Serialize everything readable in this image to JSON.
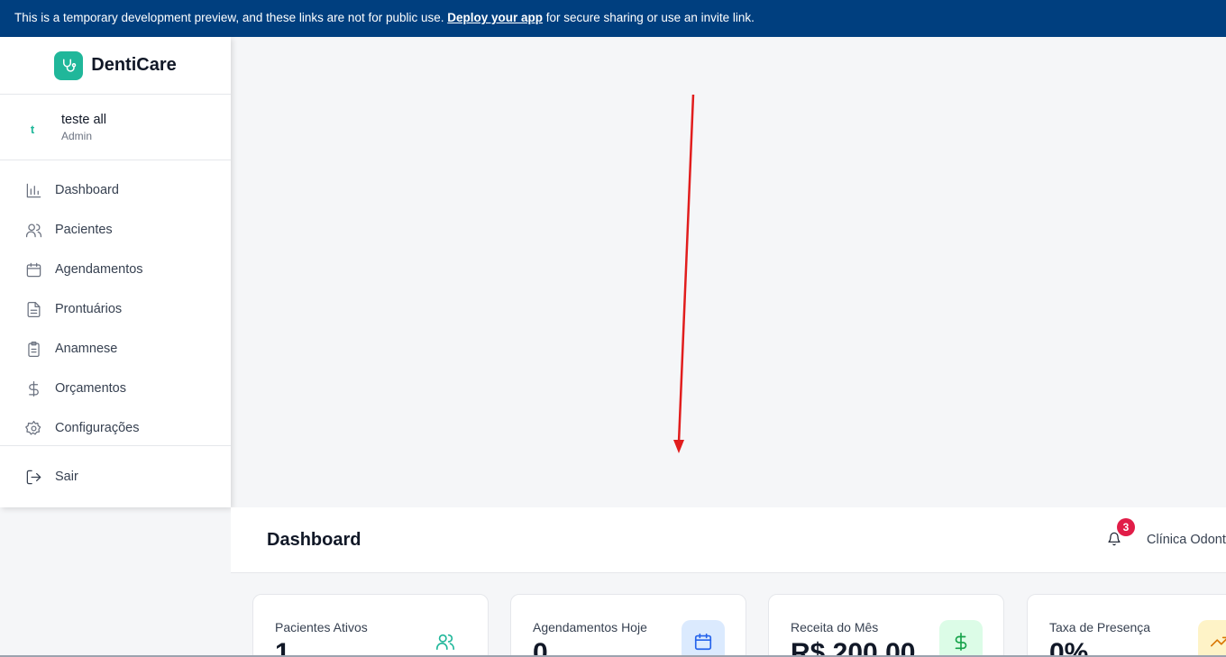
{
  "banner": {
    "text_before": "This is a temporary development preview, and these links are not for public use. ",
    "link": "Deploy your app",
    "text_after": " for secure sharing or use an invite link."
  },
  "brand": {
    "name": "DentiCare",
    "logo_icon": "stethoscope-icon"
  },
  "user": {
    "initial": "t",
    "name": "teste all",
    "role": "Admin"
  },
  "nav": [
    {
      "label": "Dashboard",
      "icon": "bar-chart-icon"
    },
    {
      "label": "Pacientes",
      "icon": "users-icon"
    },
    {
      "label": "Agendamentos",
      "icon": "calendar-icon"
    },
    {
      "label": "Prontuários",
      "icon": "file-text-icon"
    },
    {
      "label": "Anamnese",
      "icon": "clipboard-icon"
    },
    {
      "label": "Orçamentos",
      "icon": "dollar-icon"
    },
    {
      "label": "Configurações",
      "icon": "gear-icon"
    }
  ],
  "logout": {
    "label": "Sair",
    "icon": "logout-icon"
  },
  "header": {
    "title": "Dashboard",
    "notifications": "3",
    "clinic": "Clínica Odont"
  },
  "stats": [
    {
      "label": "Pacientes Ativos",
      "value": "1",
      "icon": "users-icon",
      "color": "#20b79a"
    },
    {
      "label": "Agendamentos Hoje",
      "value": "0",
      "icon": "calendar-icon",
      "color": "#2563eb"
    },
    {
      "label": "Receita do Mês",
      "value": "R$ 200,00",
      "icon": "dollar-icon",
      "color": "#16a34a"
    },
    {
      "label": "Taxa de Presença",
      "value": "0%",
      "icon": "trending-up-icon",
      "color": "#d97706"
    }
  ],
  "colors": {
    "banner": "#003f7f",
    "brand": "#20b79a",
    "annotation_arrow": "#e11d1d"
  }
}
